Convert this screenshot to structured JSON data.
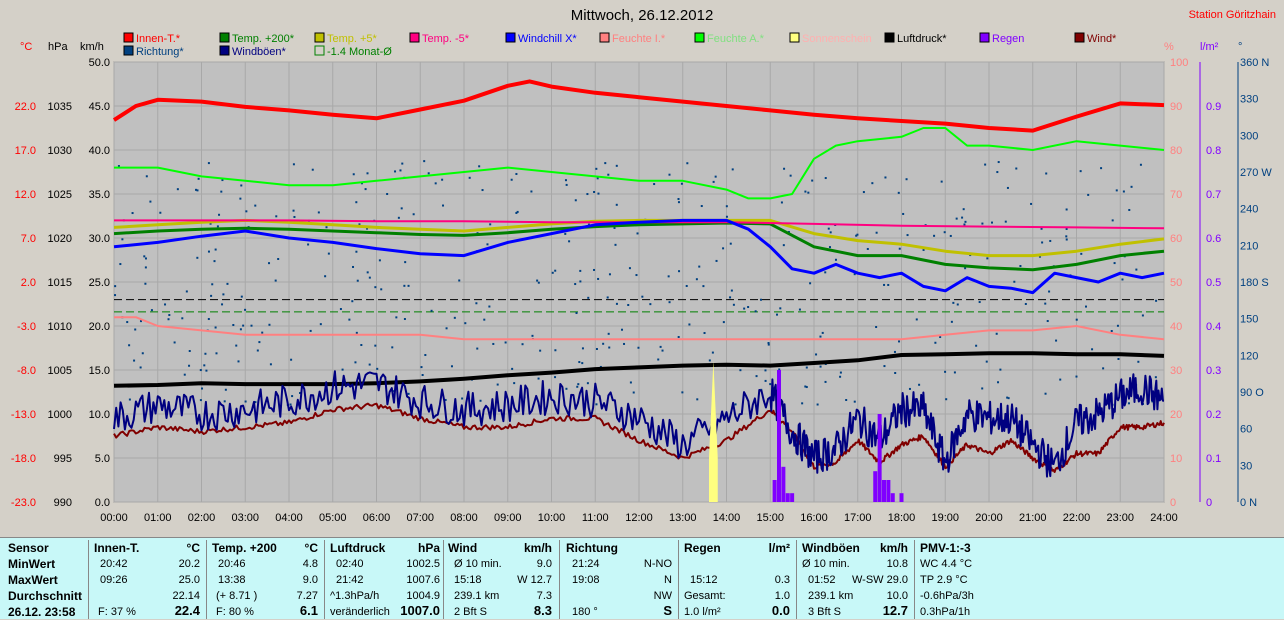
{
  "title": "Mittwoch, 26.12.2012",
  "station": "Station Göritzhain",
  "legend": [
    {
      "label": "Innen-T.*",
      "color": "#ff0000"
    },
    {
      "label": "Temp. +200*",
      "color": "#008000"
    },
    {
      "label": "Temp. +5*",
      "color": "#c0c000"
    },
    {
      "label": "Temp. -5*",
      "color": "#ff0080"
    },
    {
      "label": "Windchill X*",
      "color": "#0000ff"
    },
    {
      "label": "Feuchte I.*",
      "color": "#ff8080"
    },
    {
      "label": "Feuchte A.*",
      "color": "#00ff00"
    },
    {
      "label": "Sonnenschein",
      "color": "#ffff80"
    },
    {
      "label": "Luftdruck*",
      "color": "#000000"
    },
    {
      "label": "Regen",
      "color": "#8000ff"
    },
    {
      "label": "Wind*",
      "color": "#800000"
    },
    {
      "label": "Richtung*",
      "color": "#004080"
    },
    {
      "label": "Windböen*",
      "color": "#000080"
    },
    {
      "label": "-1.4 Monat-Ø",
      "color": "#008000"
    }
  ],
  "axis_units": {
    "temp": "°C",
    "press": "hPa",
    "wind": "km/h",
    "hum": "%",
    "rain": "l/m²",
    "dir": "°"
  },
  "chart_data": {
    "type": "line",
    "x_ticks": [
      "00:00",
      "01:00",
      "02:00",
      "03:00",
      "04:00",
      "05:00",
      "06:00",
      "07:00",
      "08:00",
      "09:00",
      "10:00",
      "11:00",
      "12:00",
      "13:00",
      "14:00",
      "15:00",
      "16:00",
      "17:00",
      "18:00",
      "19:00",
      "20:00",
      "21:00",
      "22:00",
      "23:00",
      "24:00"
    ],
    "y_temp_ticks": [
      "22.0",
      "17.0",
      "12.0",
      "7.0",
      "2.0",
      "-3.0",
      "-8.0",
      "-13.0",
      "-18.0",
      "-23.0"
    ],
    "y_press_ticks": [
      "1035",
      "1030",
      "1025",
      "1020",
      "1015",
      "1010",
      "1005",
      "1000",
      "995",
      "990"
    ],
    "y_wind_ticks": [
      "50.0",
      "45.0",
      "40.0",
      "35.0",
      "30.0",
      "25.0",
      "20.0",
      "15.0",
      "10.0",
      "5.0",
      "0.0"
    ],
    "y_hum_ticks": [
      "100",
      "90",
      "80",
      "70",
      "60",
      "50",
      "40",
      "30",
      "20",
      "10",
      "0"
    ],
    "y_rain_ticks": [
      "0.9",
      "0.8",
      "0.7",
      "0.6",
      "0.5",
      "0.4",
      "0.3",
      "0.2",
      "0.1",
      "0"
    ],
    "y_dir_ticks": [
      "360 N",
      "330",
      "300",
      "270 W",
      "240",
      "210",
      "180 S",
      "150",
      "120",
      "90 O",
      "60",
      "30",
      "0 N"
    ],
    "series": [
      {
        "name": "Innen-T.*",
        "unit": "°C",
        "x": [
          0,
          0.5,
          1,
          2,
          3,
          4,
          5,
          6,
          7,
          8,
          9,
          9.5,
          10,
          11,
          12,
          13,
          14,
          15,
          16,
          17,
          18,
          19,
          20,
          21,
          22,
          23,
          24
        ],
        "values": [
          20.4,
          22.0,
          22.7,
          22.5,
          21.9,
          21.5,
          21.0,
          20.6,
          21.6,
          22.6,
          24.3,
          24.8,
          24.2,
          23.5,
          23.0,
          22.5,
          22.0,
          21.5,
          21.0,
          20.6,
          20.3,
          20.0,
          19.5,
          19.2,
          20.8,
          22.3,
          22.1
        ]
      },
      {
        "name": "Temp. +200*",
        "unit": "°C",
        "x": [
          0,
          1,
          2,
          3,
          4,
          5,
          6,
          7,
          8,
          9,
          10,
          11,
          12,
          13,
          14,
          15,
          16,
          17,
          18,
          19,
          20,
          21,
          22,
          23,
          24
        ],
        "values": [
          7.5,
          7.8,
          8.0,
          8.1,
          8.0,
          7.8,
          7.6,
          7.4,
          7.3,
          7.6,
          8.0,
          8.3,
          8.5,
          8.6,
          8.7,
          8.6,
          6.0,
          5.0,
          5.0,
          4.0,
          3.6,
          3.4,
          4.0,
          5.0,
          5.5
        ]
      },
      {
        "name": "Temp. +5*",
        "unit": "°C",
        "x": [
          0,
          1,
          2,
          3,
          4,
          5,
          6,
          7,
          8,
          9,
          10,
          11,
          12,
          13,
          14,
          15,
          16,
          17,
          18,
          19,
          20,
          21,
          22,
          23,
          24
        ],
        "values": [
          8.2,
          8.5,
          8.8,
          9.0,
          8.8,
          8.5,
          8.2,
          8.0,
          7.8,
          8.2,
          8.6,
          8.9,
          9.0,
          9.0,
          9.0,
          9.0,
          7.5,
          6.7,
          6.3,
          5.5,
          5.0,
          5.0,
          5.5,
          6.3,
          6.9
        ]
      },
      {
        "name": "Temp. -5*",
        "unit": "°C",
        "x": [
          0,
          2,
          4,
          6,
          8,
          10,
          12,
          14,
          16,
          18,
          20,
          22,
          24
        ],
        "values": [
          9.0,
          9.0,
          9.0,
          8.9,
          8.9,
          8.8,
          8.8,
          8.8,
          8.6,
          8.4,
          8.3,
          8.2,
          8.1
        ]
      },
      {
        "name": "Windchill X*",
        "unit": "°C",
        "x": [
          0,
          1,
          2,
          3,
          4,
          5,
          6,
          7,
          8,
          9,
          10,
          11,
          12,
          13,
          14,
          14.5,
          15,
          15.5,
          16,
          16.5,
          17,
          17.5,
          18,
          18.5,
          19,
          19.5,
          20,
          20.5,
          21,
          21.5,
          22,
          22.5,
          23,
          23.5,
          24
        ],
        "values": [
          6.0,
          6.5,
          7.2,
          7.8,
          7.0,
          6.5,
          5.8,
          5.2,
          5.0,
          6.5,
          7.5,
          8.5,
          8.8,
          9.0,
          9.0,
          8.0,
          6.0,
          3.5,
          3.0,
          4.0,
          3.0,
          2.5,
          3.0,
          1.5,
          1.0,
          2.5,
          1.5,
          1.3,
          0.8,
          3.0,
          2.5,
          2.0,
          3.0,
          2.5,
          3.0
        ]
      },
      {
        "name": "Feuchte I.*",
        "unit": "%",
        "x": [
          0,
          0.5,
          1,
          2,
          3,
          4,
          5,
          6,
          7,
          8,
          9,
          10,
          11,
          12,
          13,
          14,
          15,
          16,
          17,
          18,
          19,
          20,
          21,
          22,
          23,
          24
        ],
        "values": [
          42,
          42,
          40,
          39,
          38,
          38,
          38,
          38,
          38,
          37,
          37,
          37,
          37,
          37,
          37,
          37,
          37,
          37,
          37,
          37,
          38,
          39,
          39,
          40,
          38,
          37
        ]
      },
      {
        "name": "Feuchte A.*",
        "unit": "%",
        "x": [
          0,
          1,
          2,
          3,
          4,
          5,
          6,
          7,
          8,
          9,
          10,
          11,
          12,
          13,
          14,
          14.5,
          15,
          15.5,
          16,
          16.5,
          17,
          18,
          18.5,
          19,
          19.5,
          20,
          21,
          22,
          23,
          24
        ],
        "values": [
          76,
          76,
          74,
          73,
          72,
          72,
          73,
          74,
          75,
          76,
          75,
          74,
          73,
          73,
          71,
          69,
          69,
          70,
          78,
          81,
          82,
          83,
          85,
          85,
          81,
          81,
          80,
          82,
          81,
          80
        ]
      },
      {
        "name": "Luftdruck*",
        "unit": "hPa",
        "x": [
          0,
          1,
          2,
          3,
          4,
          5,
          6,
          7,
          8,
          9,
          10,
          11,
          12,
          13,
          14,
          15,
          16,
          17,
          18,
          19,
          20,
          21,
          22,
          23,
          24
        ],
        "values": [
          1003.2,
          1003.3,
          1003.5,
          1003.4,
          1003.4,
          1003.4,
          1003.5,
          1003.7,
          1004.0,
          1004.4,
          1004.7,
          1005.1,
          1005.3,
          1005.5,
          1005.6,
          1005.5,
          1005.8,
          1006.1,
          1006.7,
          1006.8,
          1006.9,
          1006.9,
          1006.8,
          1006.8,
          1006.6
        ]
      },
      {
        "name": "Wind*",
        "unit": "km/h",
        "x": [
          0,
          1,
          2,
          3,
          4,
          5,
          6,
          7,
          8,
          9,
          10,
          11,
          12,
          13,
          14,
          15,
          15.5,
          16,
          16.5,
          17,
          17.5,
          18,
          18.5,
          19,
          19.5,
          20,
          20.5,
          21,
          21.5,
          22,
          22.5,
          23,
          23.5,
          24
        ],
        "values": [
          7.5,
          8.5,
          8.0,
          8.5,
          9.0,
          10.5,
          11.0,
          9.5,
          8.5,
          8.5,
          9.5,
          9.5,
          7.0,
          5.0,
          7.0,
          10.5,
          8.0,
          4.0,
          4.5,
          7.0,
          4.5,
          6.5,
          7.5,
          4.0,
          6.5,
          5.5,
          7.0,
          5.0,
          3.5,
          5.5,
          5.5,
          8.5,
          8.5,
          9.0
        ]
      },
      {
        "name": "Windböen*",
        "unit": "km/h",
        "x": [
          0,
          1,
          2,
          3,
          4,
          5,
          6,
          7,
          8,
          9,
          10,
          11,
          12,
          13,
          14,
          15,
          15.5,
          16,
          16.5,
          17,
          17.5,
          18,
          18.5,
          19,
          19.5,
          20,
          20.5,
          21,
          21.5,
          22,
          22.5,
          23,
          23.5,
          24
        ],
        "values": [
          9.5,
          11.0,
          10.0,
          10.5,
          11.5,
          13.0,
          13.5,
          11.5,
          10.5,
          11.0,
          12.0,
          11.5,
          9.5,
          6.5,
          9.5,
          12.5,
          8.0,
          5.0,
          6.0,
          9.5,
          7.0,
          10.5,
          10.5,
          4.5,
          10.0,
          9.5,
          9.5,
          6.5,
          4.0,
          9.0,
          10.0,
          12.0,
          13.0,
          11.5
        ]
      },
      {
        "name": "Regen",
        "unit": "l/m²",
        "x": [
          15.1,
          15.2,
          15.3,
          15.4,
          15.5,
          17.4,
          17.5,
          17.6,
          17.7,
          17.8,
          18.0
        ],
        "values": [
          0.05,
          0.3,
          0.08,
          0.02,
          0.02,
          0.07,
          0.2,
          0.05,
          0.05,
          0.02,
          0.02
        ]
      },
      {
        "name": "Sonnenschein",
        "unit": "",
        "x": [
          13.6,
          13.7,
          13.8
        ],
        "values": [
          5,
          16,
          5
        ]
      }
    ],
    "monthly_average_line": {
      "label": "-1.4 Monat-Ø",
      "value": -1.4
    }
  },
  "stats": {
    "sensor": {
      "title": "Sensor",
      "rows": [
        "MinWert",
        "MaxWert",
        "Durchschnitt",
        "26.12. 23:58"
      ]
    },
    "innen": {
      "title": "Innen-T.",
      "unit": "°C",
      "min_time": "20:42",
      "min": "20.2",
      "max_time": "09:26",
      "max": "25.0",
      "avg": "22.14",
      "cur_note": "F: 37 %",
      "cur": "22.4"
    },
    "temp200": {
      "title": "Temp. +200",
      "unit": "°C",
      "min_time": "20:46",
      "min": "4.8",
      "max_time": "13:38",
      "max": "9.0",
      "avg_note": "(+ 8.71 )",
      "avg": "7.27",
      "cur_note": "F: 80 %",
      "cur": "6.1"
    },
    "luftdruck": {
      "title": "Luftdruck",
      "unit": "hPa",
      "min_time": "02:40",
      "min": "1002.5",
      "max_time": "21:42",
      "max": "1007.6",
      "avg_note": "^1.3hPa/h",
      "avg": "1004.9",
      "cur_note": "veränderlich",
      "cur": "1007.0"
    },
    "wind": {
      "title": "Wind",
      "unit": "km/h",
      "r1a": "Ø 10 min.",
      "r1b": "9.0",
      "r2a": "15:18",
      "r2b": "W 12.7",
      "r3a": "239.1 km",
      "r3b": "7.3",
      "r4a": "2 Bft S",
      "r4b": "8.3"
    },
    "richtung": {
      "title": "Richtung",
      "r1a": "21:24",
      "r1b": "N-NO",
      "r2a": "19:08",
      "r2b": "N",
      "r3b": "NW",
      "r4a": "180 °",
      "r4b": "S"
    },
    "regen": {
      "title": "Regen",
      "unit": "l/m²",
      "r2a": "15:12",
      "r2b": "0.3",
      "r3a": "Gesamt:",
      "r3b": "1.0",
      "r4a": "1.0 l/m²",
      "r4b": "0.0"
    },
    "windboeen": {
      "title": "Windböen",
      "unit": "km/h",
      "r1a": "Ø 10 min.",
      "r1b": "10.8",
      "r2a": "01:52",
      "r2b": "W-SW 29.0",
      "r3a": "239.1 km",
      "r3b": "10.0",
      "r4a": "3 Bft S",
      "r4b": "12.7"
    },
    "pmv": {
      "title": "PMV-1:-3",
      "r1": "WC 4.4 °C",
      "r2": "TP 2.9 °C",
      "r3": "-0.6hPa/3h",
      "r4": "0.3hPa/1h"
    }
  }
}
